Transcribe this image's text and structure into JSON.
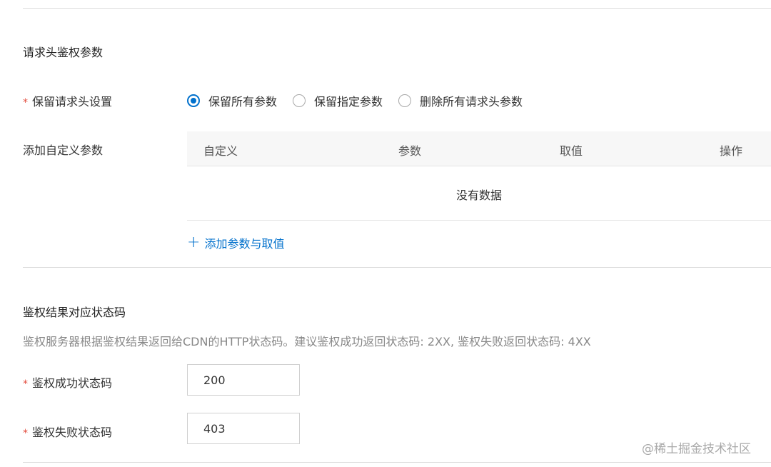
{
  "header_section": {
    "title": "请求头鉴权参数"
  },
  "retain_header": {
    "required_mark": "*",
    "label": "保留请求头设置",
    "options": [
      {
        "label": "保留所有参数",
        "checked": true
      },
      {
        "label": "保留指定参数",
        "checked": false
      },
      {
        "label": "删除所有请求头参数",
        "checked": false
      }
    ]
  },
  "custom_params": {
    "label": "添加自定义参数",
    "columns": [
      "自定义",
      "参数",
      "取值",
      "操作"
    ],
    "empty_text": "没有数据",
    "add_icon": "plus-icon",
    "add_label": "添加参数与取值"
  },
  "status_section": {
    "title": "鉴权结果对应状态码",
    "description": "鉴权服务器根据鉴权结果返回给CDN的HTTP状态码。建议鉴权成功返回状态码: 2XX, 鉴权失败返回状态码: 4XX",
    "success": {
      "required_mark": "*",
      "label": "鉴权成功状态码",
      "value": "200"
    },
    "failure": {
      "required_mark": "*",
      "label": "鉴权失败状态码",
      "value": "403"
    }
  },
  "watermark": "@稀土掘金技术社区",
  "colors": {
    "accent": "#0070cc",
    "required": "#e34d3e",
    "divider": "#dcdcdc",
    "table_header_bg": "#f7f7f7",
    "muted_text": "#888888"
  }
}
